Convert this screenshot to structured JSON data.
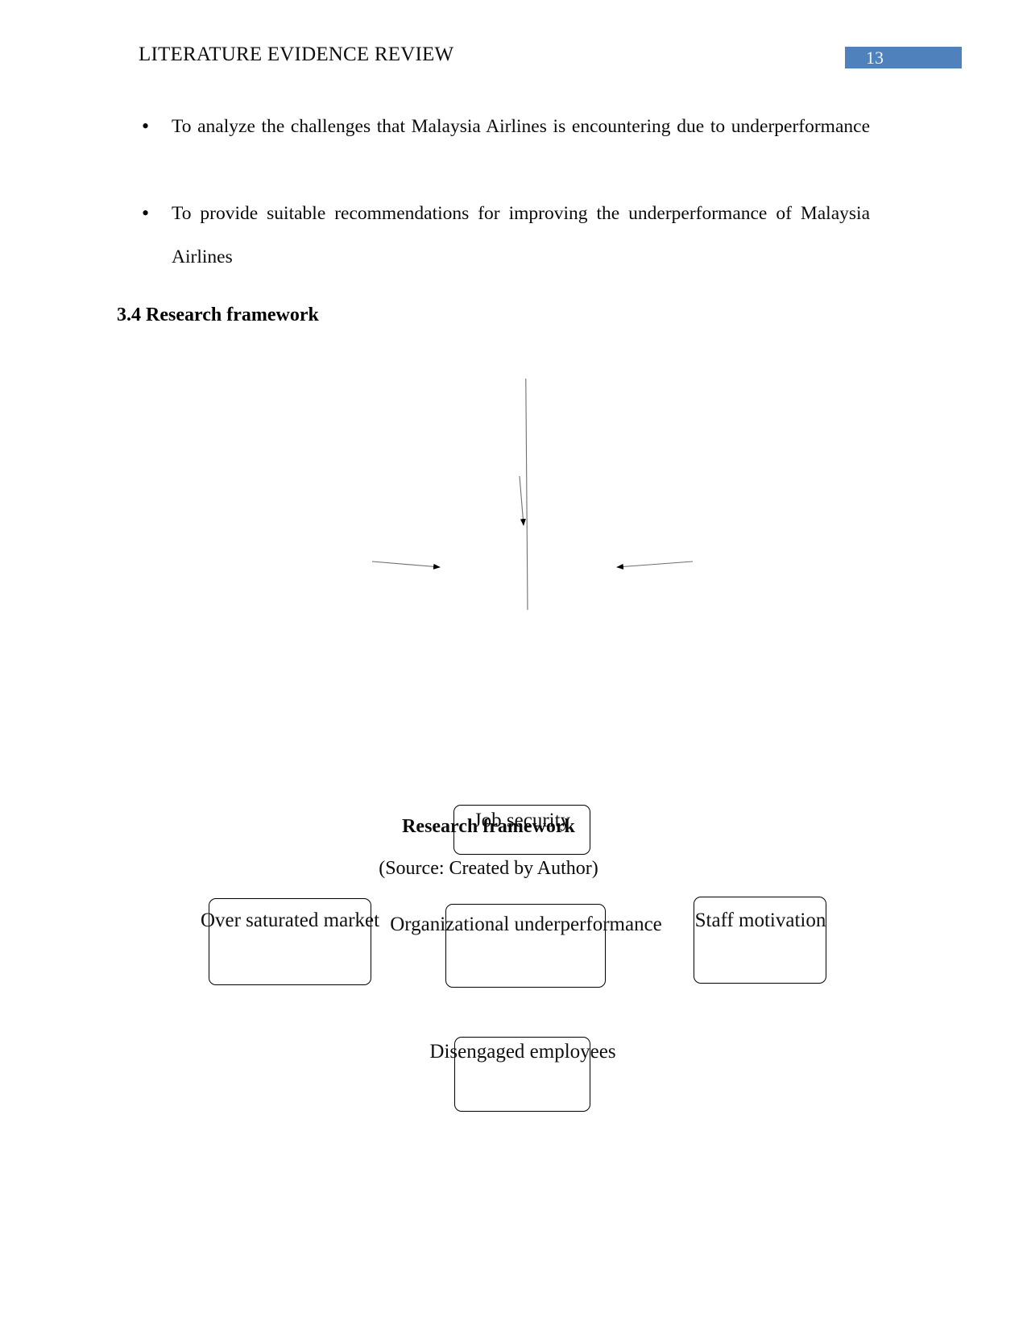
{
  "document": {
    "header": {
      "title": "LITERATURE EVIDENCE REVIEW",
      "page_number": "13",
      "badge_color": "#4f81bd"
    },
    "bullets": [
      {
        "marker": "•",
        "text": "To analyze the challenges that Malaysia Airlines is encountering due to underperformance"
      },
      {
        "marker": "•",
        "text": "To provide suitable recommendations for improving the underperformance of Malaysia Airlines"
      }
    ],
    "section": {
      "heading": "3.4 Research framework"
    },
    "figure": {
      "nodes": {
        "top": "Job security",
        "left": "Over saturated market",
        "center": "Organizational underperformance",
        "right": "Staff motivation",
        "bottom": "Disengaged employees"
      },
      "caption_title": "Research framework",
      "caption_source": "(Source: Created by Author)"
    }
  }
}
